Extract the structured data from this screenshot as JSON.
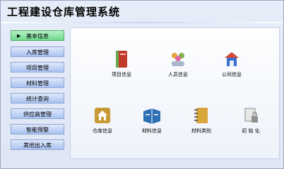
{
  "app": {
    "title": "工程建设仓库管理系统"
  },
  "sidebar": {
    "items": [
      {
        "label": "基本信息",
        "active": true
      },
      {
        "label": "入库管理"
      },
      {
        "label": "项目管理"
      },
      {
        "label": "材料管理"
      },
      {
        "label": "统计查询"
      },
      {
        "label": "供应商管理"
      },
      {
        "label": "智能预警"
      },
      {
        "label": "其他出入库"
      }
    ]
  },
  "tiles": [
    {
      "label": "项目信息",
      "icon": "book-icon",
      "color": "#c0392b"
    },
    {
      "label": "人员信息",
      "icon": "people-icon",
      "color": "#e8a33c"
    },
    {
      "label": "公司信息",
      "icon": "company-icon",
      "color": "#3a6fcf"
    },
    {
      "label": "仓库信息",
      "icon": "warehouse-icon",
      "color": "#c79a36"
    },
    {
      "label": "材料信息",
      "icon": "material-book-icon",
      "color": "#2c6fb3"
    },
    {
      "label": "材料类别",
      "icon": "category-notebook-icon",
      "color": "#d8a63b"
    },
    {
      "label": "初 始 化",
      "icon": "init-lock-icon",
      "color": "#8f8f8f"
    }
  ],
  "colors": {
    "accent": "#6cd78c",
    "nav": "#a9c2f0"
  }
}
